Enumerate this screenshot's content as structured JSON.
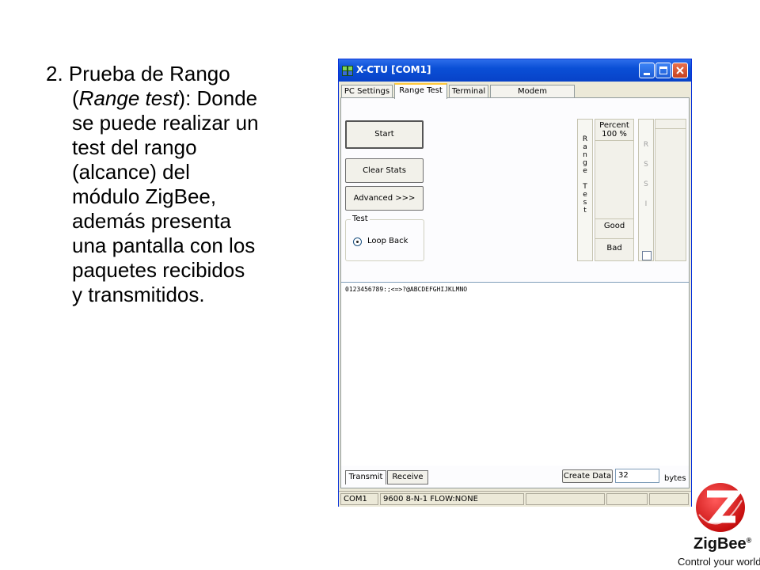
{
  "slide": {
    "lines": [
      "2. Prueba de Rango",
      "(Range test): Donde",
      "se puede realizar un",
      "test del rango",
      "(alcance) del",
      "módulo ZigBee,",
      "además presenta",
      "una pantalla con los",
      "paquetes recibidos",
      "y transmitidos."
    ],
    "line1_italic": "Range test",
    "line1_rest": "): Donde",
    "line1_open": "("
  },
  "window": {
    "title": "X-CTU  [COM1]",
    "tabs": [
      "PC Settings",
      "Range Test",
      "Terminal",
      "Modem Configuration"
    ],
    "active_tab": "Range Test",
    "buttons": {
      "start": "Start",
      "clear_stats": "Clear Stats",
      "advanced": "Advanced >>>"
    },
    "test_group": {
      "legend": "Test",
      "option": "Loop Back",
      "selected": true
    },
    "range_test_label": [
      "R",
      "a",
      "n",
      "g",
      "e",
      "",
      "T",
      "e",
      "s",
      "t"
    ],
    "rssi_label": [
      "R",
      "S",
      "S",
      "I"
    ],
    "meter": {
      "percent_label": "Percent",
      "percent_value": "100 %",
      "good": "Good",
      "bad": "Bad"
    },
    "rssi_checkbox_checked": false,
    "data_text": "0123456789:;<=>?@ABCDEFGHIJKLMNO",
    "bottom": {
      "transmit_tab": "Transmit",
      "receive_tab": "Receive",
      "create_data": "Create Data",
      "bytes_value": "32",
      "bytes_label": "bytes"
    },
    "status": [
      "COM1",
      "9600 8-N-1  FLOW:NONE",
      "",
      "",
      ""
    ]
  },
  "logo": {
    "name": "ZigBee",
    "registered": "®",
    "tagline": "Control your world",
    "color": "#d01818"
  }
}
